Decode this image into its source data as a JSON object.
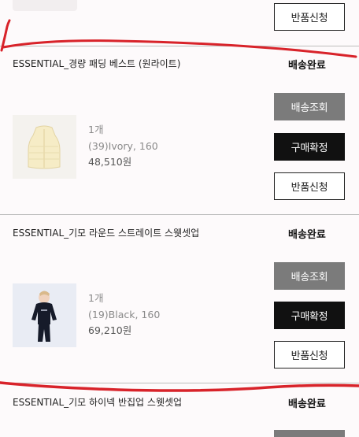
{
  "top": {
    "return_label": "반품신청"
  },
  "orders": [
    {
      "title": "ESSENTIAL_경량 패딩 베스트 (원라이트)",
      "status": "배송완료",
      "quantity": "1개",
      "option": "(39)Ivory, 160",
      "price": "48,510원",
      "buttons": {
        "track": "배송조회",
        "confirm": "구매확정",
        "return": "반품신청"
      }
    },
    {
      "title": "ESSENTIAL_기모 라운드 스트레이트 스웻셋업",
      "status": "배송완료",
      "quantity": "1개",
      "option": "(19)Black, 160",
      "price": "69,210원",
      "buttons": {
        "track": "배송조회",
        "confirm": "구매확정",
        "return": "반품신청"
      }
    },
    {
      "title": "ESSENTIAL_기모 하이넥 반집업 스웻셋업",
      "status": "배송완료"
    }
  ],
  "colors": {
    "annotation_red": "#d8232a",
    "button_gray": "#7b7b7b",
    "button_black": "#111111"
  }
}
